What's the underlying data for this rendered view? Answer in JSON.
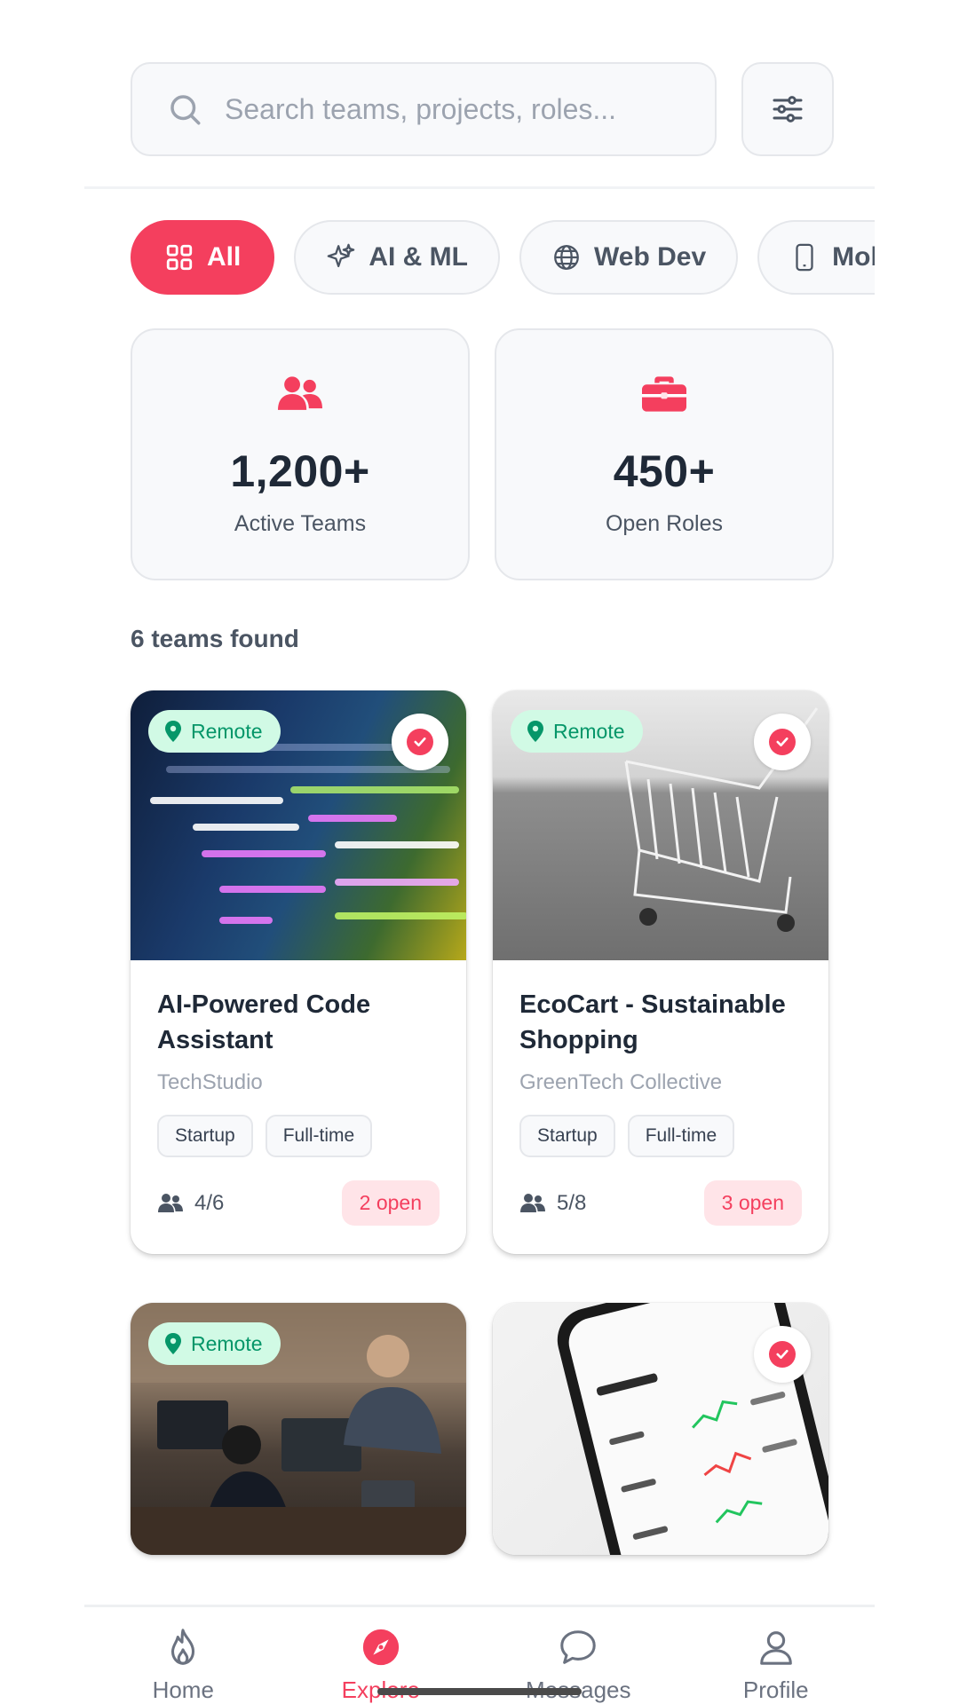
{
  "search": {
    "placeholder": "Search teams, projects, roles..."
  },
  "categories": [
    {
      "label": "All",
      "icon": "grid-icon",
      "active": true
    },
    {
      "label": "AI & ML",
      "icon": "sparkles-icon",
      "active": false
    },
    {
      "label": "Web Dev",
      "icon": "globe-icon",
      "active": false
    },
    {
      "label": "Mobil",
      "icon": "mobile-icon",
      "active": false
    }
  ],
  "stats": [
    {
      "value": "1,200+",
      "label": "Active Teams",
      "icon": "users-icon"
    },
    {
      "value": "450+",
      "label": "Open Roles",
      "icon": "briefcase-icon"
    }
  ],
  "results_text": "6 teams found",
  "teams": [
    {
      "title": "AI-Powered Code Assistant",
      "company": "TechStudio",
      "tags": [
        "Startup",
        "Full-time"
      ],
      "members": "4/6",
      "open": "2 open",
      "remote_label": "Remote",
      "image": "code-screen-photo"
    },
    {
      "title": "EcoCart - Sustainable Shopping",
      "company": "GreenTech Collective",
      "tags": [
        "Startup",
        "Full-time"
      ],
      "members": "5/8",
      "open": "3 open",
      "remote_label": "Remote",
      "image": "shopping-cart-photo"
    },
    {
      "remote_label": "Remote",
      "image": "team-working-photo"
    },
    {
      "image": "crypto-phone-photo"
    }
  ],
  "nav": [
    {
      "label": "Home",
      "icon": "flame-icon",
      "active": false
    },
    {
      "label": "Explore",
      "icon": "compass-icon",
      "active": true
    },
    {
      "label": "Messages",
      "icon": "chat-icon",
      "active": false
    },
    {
      "label": "Profile",
      "icon": "user-icon",
      "active": false
    }
  ],
  "colors": {
    "accent": "#f43f5e",
    "remote_bg": "#d1fae5",
    "remote_text": "#059669"
  }
}
